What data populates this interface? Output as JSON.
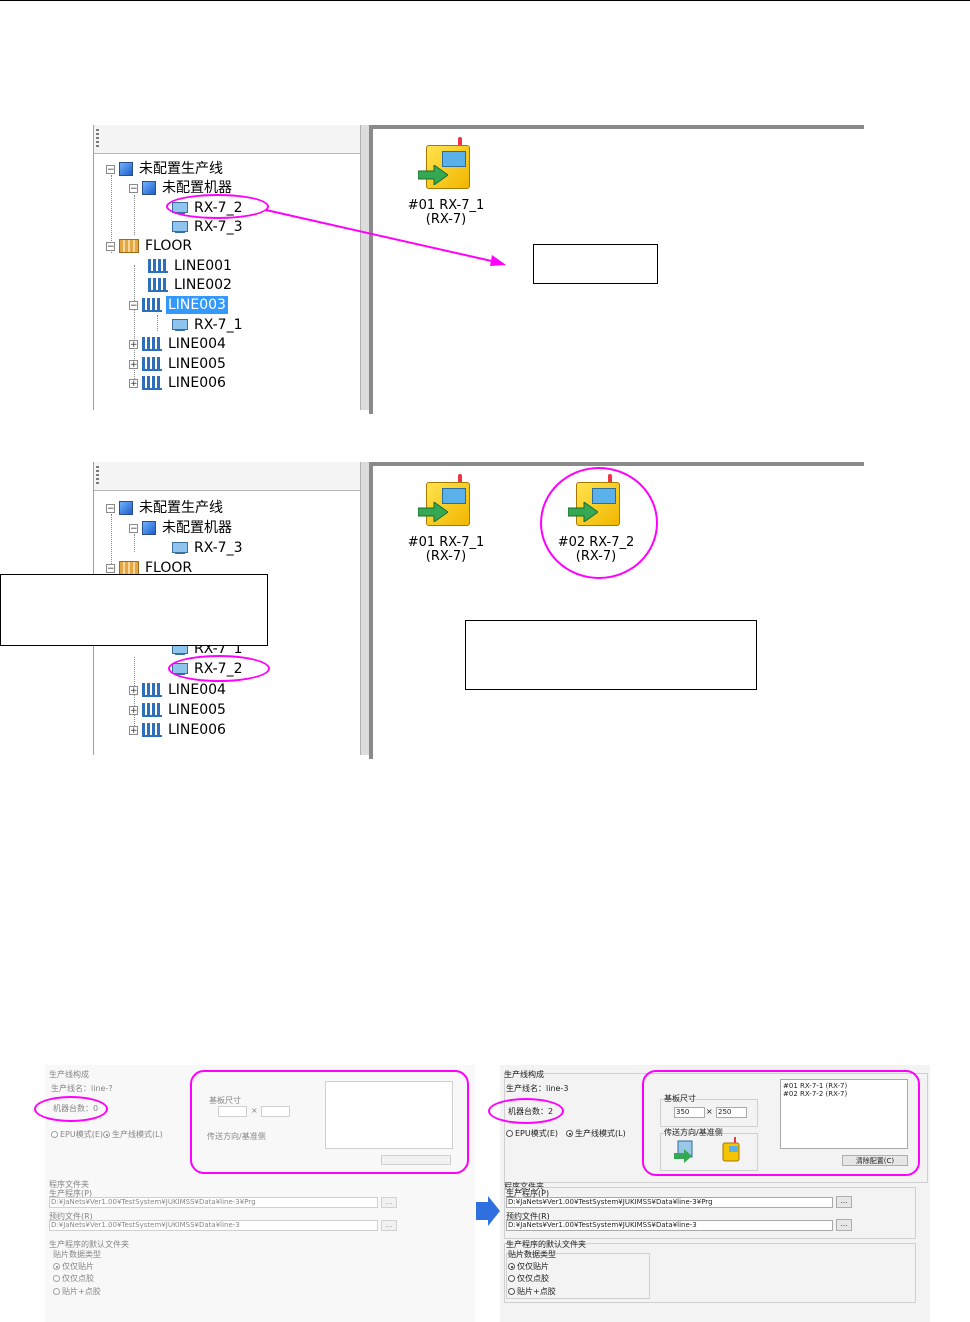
{
  "top_tree": {
    "rows": [
      "未配置生产线",
      "未配置机器",
      "RX-7_2",
      "RX-7_3",
      "FLOOR",
      "LINE001",
      "LINE002",
      "LINE003",
      "RX-7_1",
      "LINE004",
      "LINE005",
      "LINE006"
    ]
  },
  "top_view": {
    "machine1": {
      "label1": "#01 RX-7_1",
      "label2": "(RX-7)"
    }
  },
  "bottom_tree": {
    "rows": [
      "未配置生产线",
      "未配置机器",
      "RX-7_3",
      "FLOOR",
      "RX-7_1",
      "RX-7_2",
      "LINE004",
      "LINE005",
      "LINE006"
    ]
  },
  "bottom_view": {
    "machine1": {
      "label1": "#01 RX-7_1",
      "label2": "(RX-7)"
    },
    "machine2": {
      "label1": "#02 RX-7_2",
      "label2": "(RX-7)"
    }
  },
  "dialog_before": {
    "group_title": "生产线构成",
    "line_name": "生产线名：line-?",
    "machine_count": "机器台数：0",
    "radio_epu": "EPU模式(E)",
    "radio_line": "生产线模式(L)",
    "board_size_label": "基板尺寸",
    "times": "×",
    "direction_label": "传送方向/基准侧",
    "folder_title": "程序文件夹",
    "prod_label": "生产程序(P)",
    "prod_path": "D:¥JaNets¥Ver1.00¥TestSystem¥JUKIMSS¥Data¥line-3¥Prg",
    "lib_label": "预约文件(R)",
    "lib_path": "D:¥JaNets¥Ver1.00¥TestSystem¥JUKIMSS¥Data¥line-3",
    "browse": "...",
    "default_folder_title": "生产程序的默认文件夹",
    "mount_type": "贴片数据类型",
    "opt1": "仅仅贴片",
    "opt2": "仅仅点胶",
    "opt3": "贴片+点胶"
  },
  "dialog_after": {
    "group_title": "生产线构成",
    "line_name": "生产线名：line-3",
    "machine_count": "机器台数：2",
    "radio_epu": "EPU模式(E)",
    "radio_line": "生产线模式(L)",
    "board_size_label": "基板尺寸",
    "board_w": "350",
    "times": "×",
    "board_h": "250",
    "direction_label": "传送方向/基准侧",
    "list_item1": "#01 RX-7-1 (RX-7)",
    "list_item2": "#02 RX-7-2 (RX-7)",
    "clear_button": "清除配置(C)",
    "folder_title": "程序文件夹",
    "prod_label": "生产程序(P)",
    "prod_path": "D:¥JaNets¥Ver1.00¥TestSystem¥JUKIMSS¥Data¥line-3¥Prg",
    "lib_label": "预约文件(R)",
    "lib_path": "D:¥JaNets¥Ver1.00¥TestSystem¥JUKIMSS¥Data¥line-3",
    "browse": "...",
    "default_folder_title": "生产程序的默认文件夹",
    "mount_type": "贴片数据类型",
    "opt1": "仅仅贴片",
    "opt2": "仅仅点胶",
    "opt3": "贴片+点胶"
  },
  "colors": {
    "highlight": "#ff00ff",
    "selection": "#3399ff",
    "arrow_blue": "#2f6fe0"
  }
}
